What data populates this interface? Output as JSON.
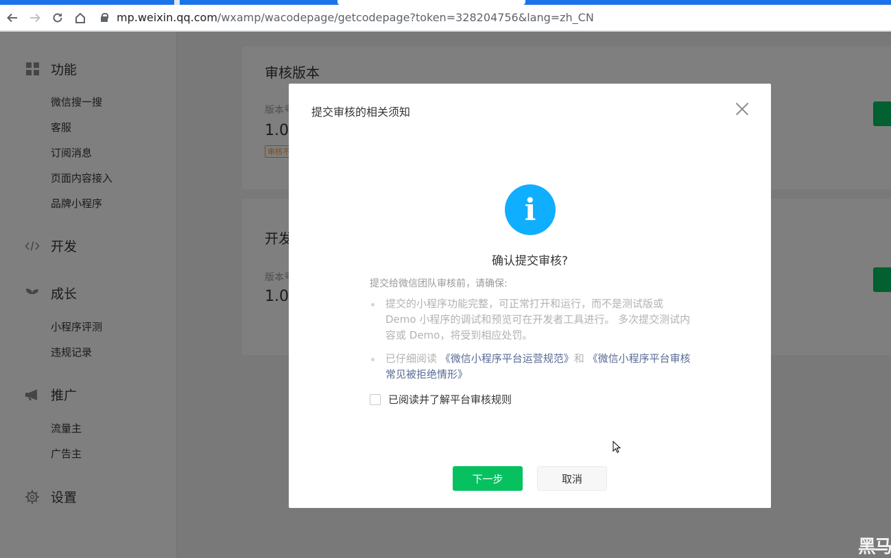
{
  "browser": {
    "url_host": "mp.weixin.qq.com",
    "url_path": "/wxamp/wacodepage/getcodepage?token=328204756&lang=zh_CN",
    "icons": [
      "back-arrow-icon",
      "forward-arrow-icon",
      "reload-icon",
      "home-icon",
      "lock-icon"
    ]
  },
  "sidebar": {
    "groups": [
      {
        "label": "功能",
        "icon": "grid-icon",
        "items": [
          "微信搜一搜",
          "客服",
          "订阅消息",
          "页面内容接入",
          "品牌小程序"
        ]
      },
      {
        "label": "开发",
        "icon": "code-icon",
        "items": []
      },
      {
        "label": "成长",
        "icon": "sprout-icon",
        "items": [
          "小程序评测",
          "违规记录"
        ]
      },
      {
        "label": "推广",
        "icon": "megaphone-icon",
        "items": [
          "流量主",
          "广告主"
        ]
      },
      {
        "label": "设置",
        "icon": "gear-icon",
        "items": []
      }
    ]
  },
  "main": {
    "review_card": {
      "title": "审核版本",
      "sub_label": "版本号",
      "version": "1.0.",
      "tag": "审核不"
    },
    "dev_card": {
      "title": "开发",
      "sub_label": "版本号",
      "version": "1.0."
    }
  },
  "dialog": {
    "title": "提交审核的相关须知",
    "confirm_title": "确认提交审核?",
    "intro": "提交给微信团队审核前，请确保:",
    "rule1": "提交的小程序功能完整，可正常打开和运行，而不是测试版或 Demo 小程序的调试和预览可在开发者工具进行。 多次提交测试内容或 Demo，将受到相应处罚。",
    "rule2_prefix": "已仔细阅读 ",
    "rule2_link1": "《微信小程序平台运营规范》",
    "rule2_mid": "和 ",
    "rule2_link2": "《微信小程序平台审核常见被拒绝情形》",
    "agree_label": "已阅读并了解平台审核规则",
    "next_label": "下一步",
    "cancel_label": "取消",
    "info_glyph": "i"
  },
  "watermark": "黑马",
  "colors": {
    "brand_green": "#07c160",
    "info_blue": "#10aeff",
    "link": "#576b95",
    "chrome_blue": "#1a73e8"
  }
}
